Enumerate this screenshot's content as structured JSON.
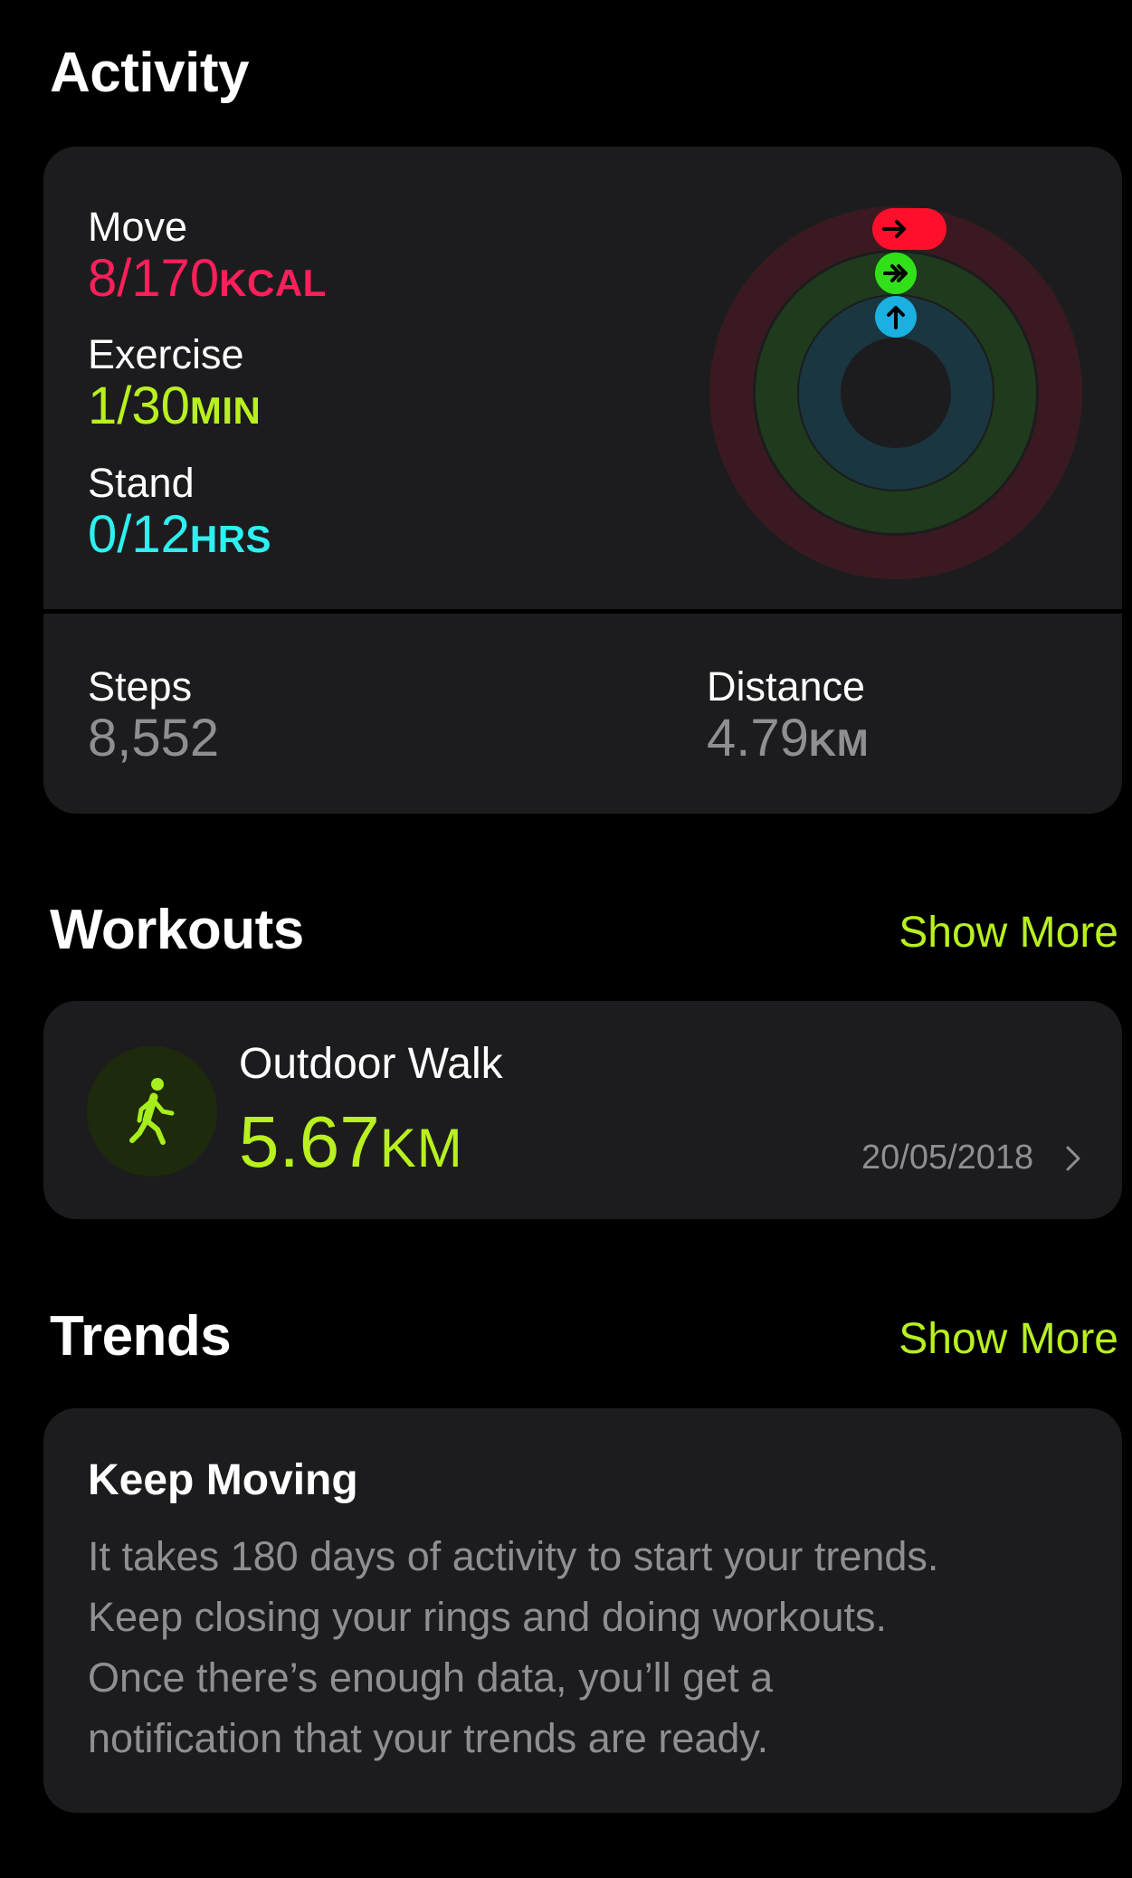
{
  "activity": {
    "title": "Activity",
    "move": {
      "label": "Move",
      "value": "8/170",
      "unit": "KCAL",
      "color": "#ff1f5a",
      "progress": 0.047
    },
    "exercise": {
      "label": "Exercise",
      "value": "1/30",
      "unit": "MIN",
      "color": "#b8f020",
      "progress": 0.033
    },
    "stand": {
      "label": "Stand",
      "value": "0/12",
      "unit": "HRS",
      "color": "#2ef0f0",
      "progress": 0.0
    },
    "steps": {
      "label": "Steps",
      "value": "8,552"
    },
    "distance": {
      "label": "Distance",
      "value": "4.79",
      "unit": "KM"
    }
  },
  "workouts": {
    "title": "Workouts",
    "show_more": "Show More",
    "item": {
      "icon": "walking-figure-icon",
      "title": "Outdoor Walk",
      "value": "5.67",
      "unit": "KM",
      "date": "20/05/2018"
    }
  },
  "trends": {
    "title": "Trends",
    "show_more": "Show More",
    "card_title": "Keep Moving",
    "card_lines": [
      "It takes 180 days of activity to start your trends.",
      "Keep closing your rings and doing workouts.",
      "Once there’s enough data, you’ll get a",
      "notification that your trends are ready."
    ]
  }
}
